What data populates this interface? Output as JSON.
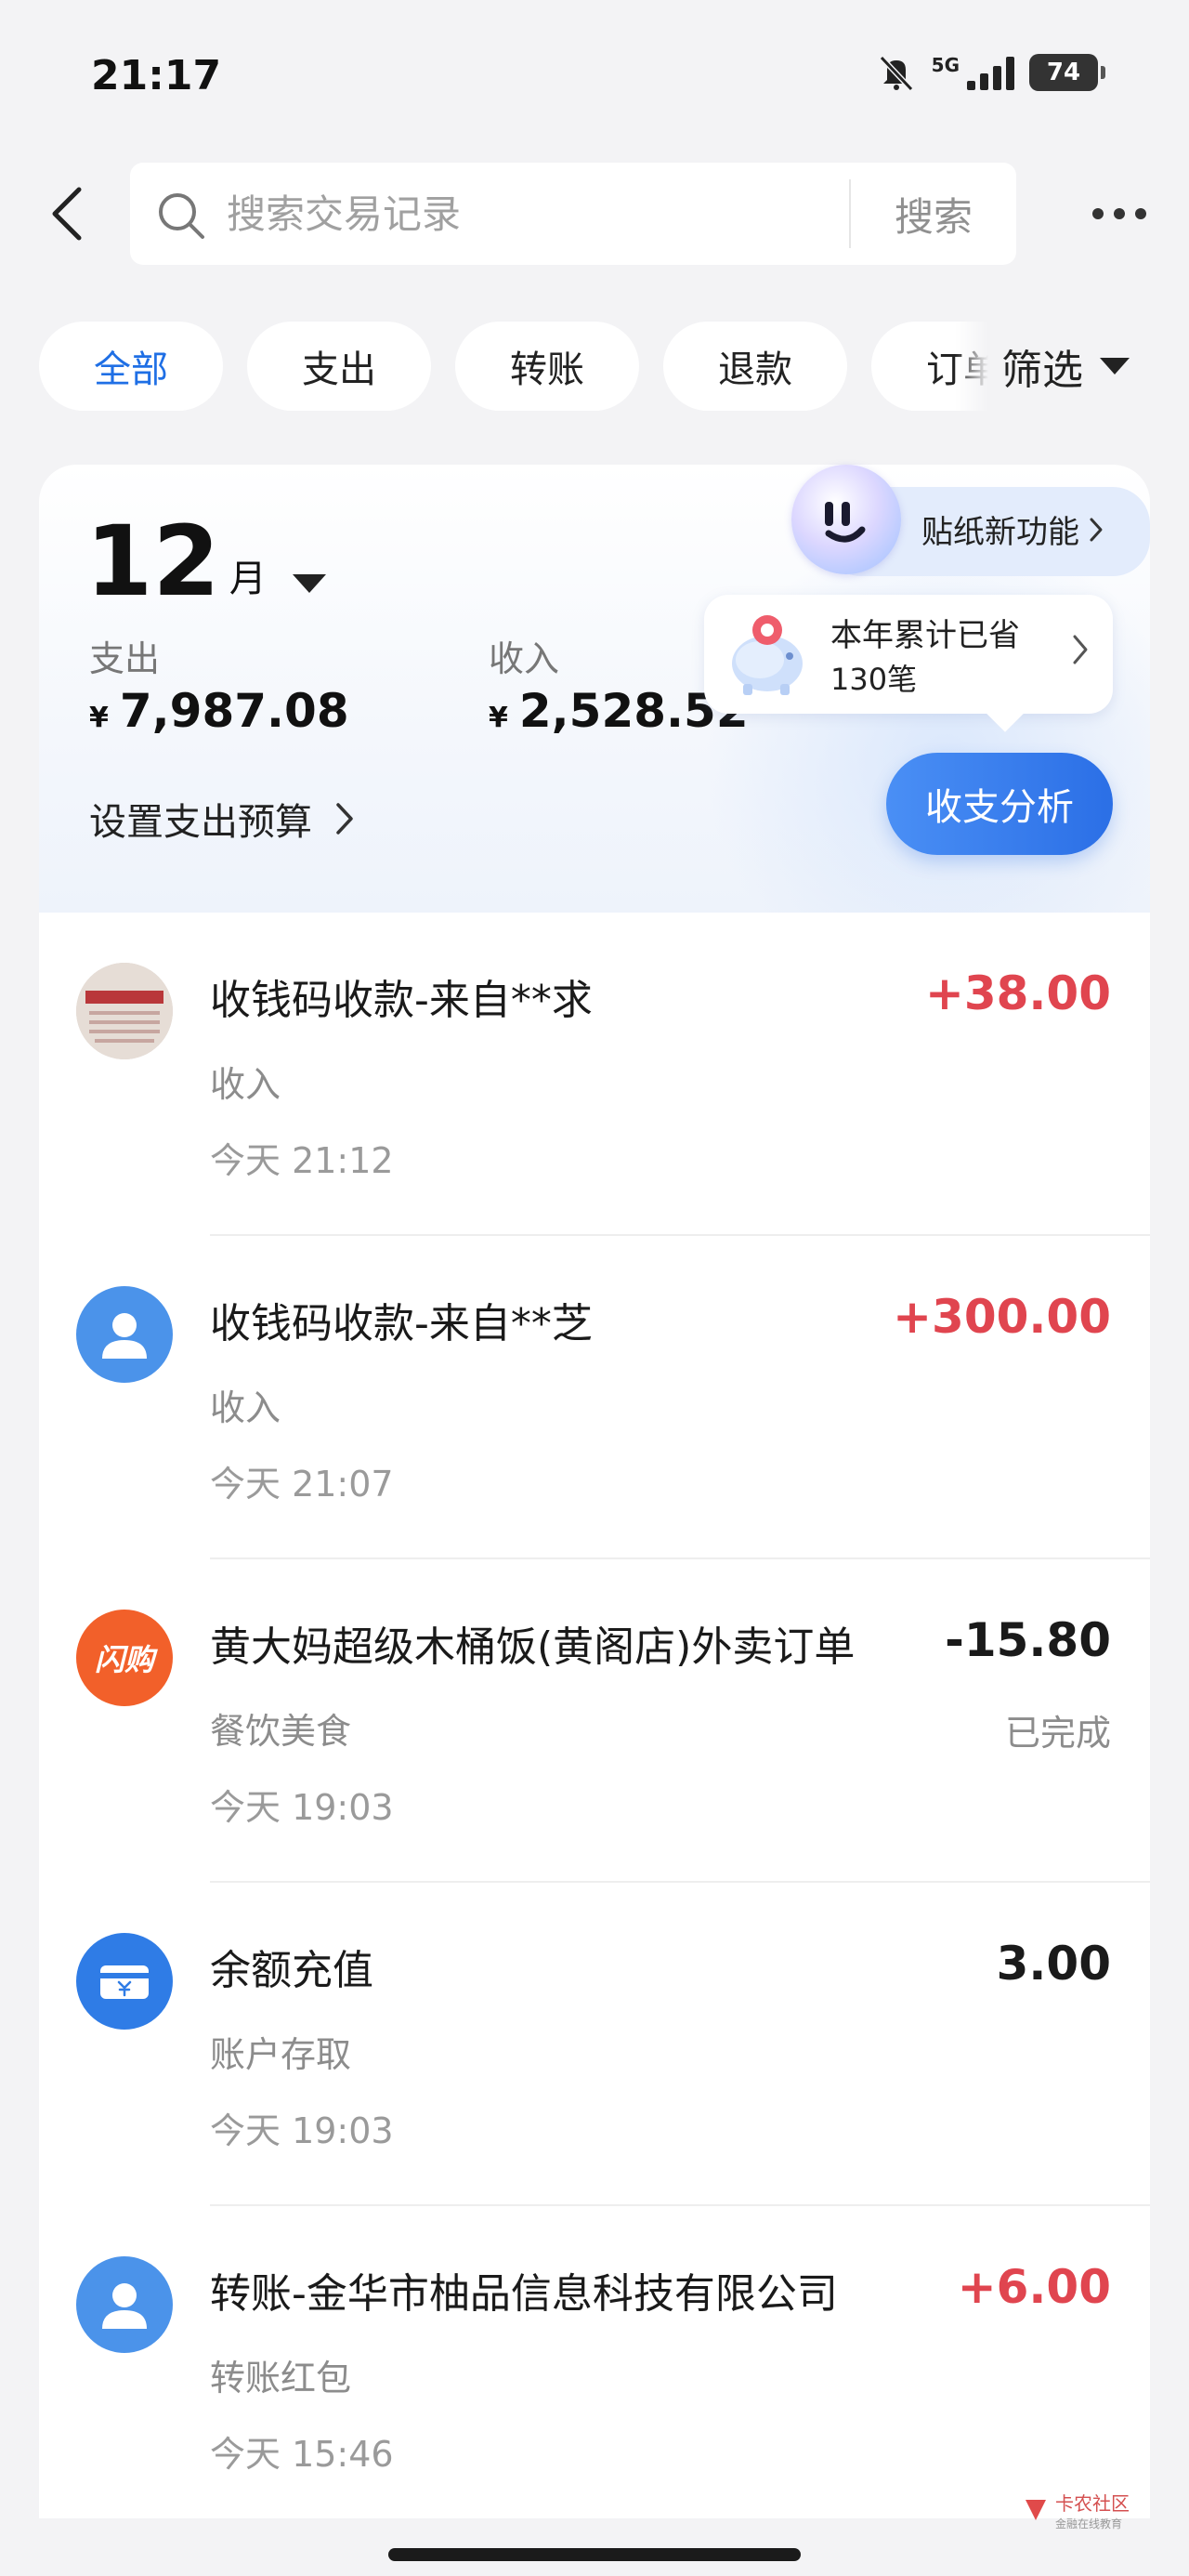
{
  "status_bar": {
    "time": "21:17",
    "network": "5G",
    "battery": "74"
  },
  "header": {
    "search_placeholder": "搜索交易记录",
    "search_button": "搜索"
  },
  "filters": {
    "chips": [
      "全部",
      "支出",
      "转账",
      "退款",
      "订单"
    ],
    "active": "全部",
    "filter_label": "筛选"
  },
  "summary": {
    "month": "12",
    "month_unit": "月",
    "expense_label": "支出",
    "expense_value": "7,987.08",
    "income_label": "收入",
    "income_value": "2,528.52",
    "currency": "¥",
    "budget_link": "设置支出预算",
    "analysis_button": "收支分析",
    "sticker_label": "贴纸新功能",
    "savings_title": "本年累计已省",
    "savings_count": "130笔"
  },
  "transactions": [
    {
      "title": "收钱码收款-来自**求",
      "category": "收入",
      "time": "今天 21:12",
      "amount": "+38.00",
      "status": "",
      "avatar": "seal"
    },
    {
      "title": "收钱码收款-来自**芝",
      "category": "收入",
      "time": "今天 21:07",
      "amount": "+300.00",
      "status": "",
      "avatar": "user"
    },
    {
      "title": "黄大妈超级木桶饭(黄阁店)外卖订单",
      "category": "餐饮美食",
      "time": "今天 19:03",
      "amount": "-15.80",
      "status": "已完成",
      "avatar": "shangou",
      "avatar_text": "闪购"
    },
    {
      "title": "余额充值",
      "category": "账户存取",
      "time": "今天 19:03",
      "amount": "3.00",
      "status": "",
      "avatar": "wallet"
    },
    {
      "title": "转账-金华市柚品信息科技有限公司",
      "category": "转账红包",
      "time": "今天 15:46",
      "amount": "+6.00",
      "status": "",
      "avatar": "user"
    }
  ],
  "watermark": {
    "text": "卡农社区",
    "sub": "金融在线教育"
  },
  "colors": {
    "accent": "#1f6fe5",
    "positive": "#e0454f",
    "shangou": "#f2602a",
    "avatar_blue": "#4b93ea"
  },
  "icons": [
    "back-arrow-icon",
    "search-icon",
    "more-icon",
    "caret-down-icon",
    "chevron-right-icon",
    "user-icon",
    "wallet-icon",
    "piggy-bank-icon",
    "sticker-face-icon"
  ]
}
